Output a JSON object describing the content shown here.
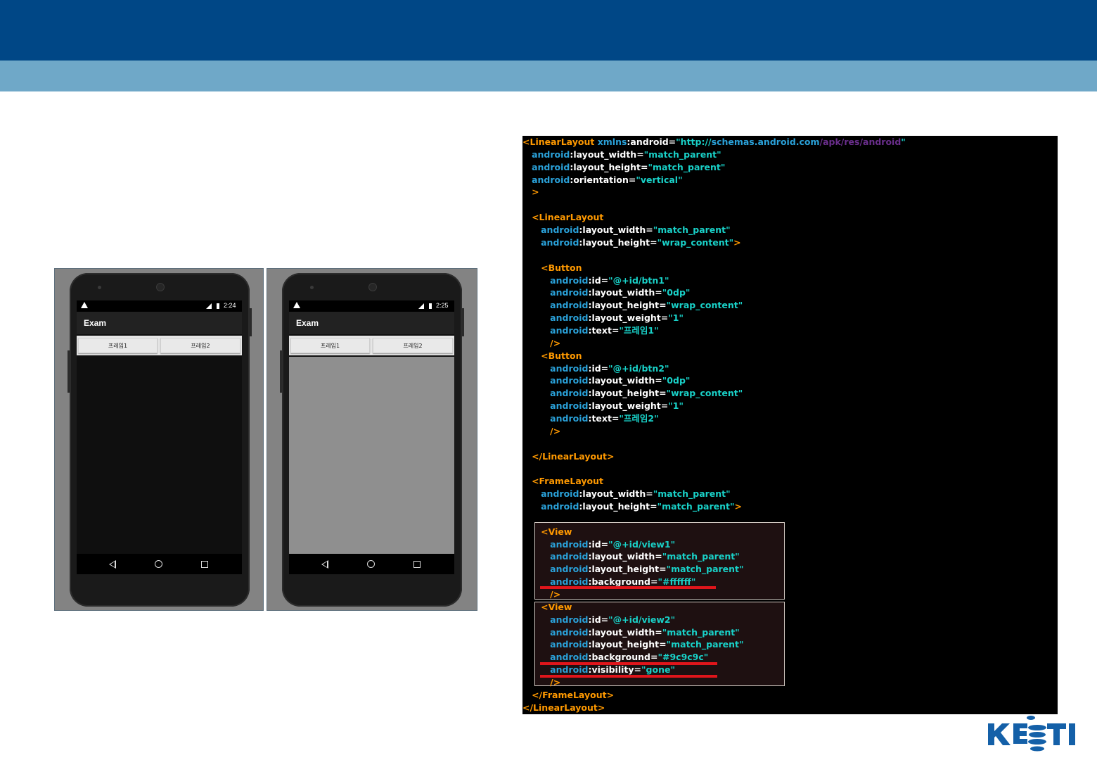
{
  "screenshots": [
    {
      "time": "2:24",
      "app_title": "Exam",
      "button1": "프레임1",
      "button2": "프레임2",
      "content_color": "#0f0f0f"
    },
    {
      "time": "2:25",
      "app_title": "Exam",
      "button1": "프레임1",
      "button2": "프레임2",
      "content_color": "#8f8f8f"
    }
  ],
  "code": {
    "lines": [
      [
        [
          "b",
          "<"
        ],
        [
          "b",
          "LinearLayout"
        ],
        [
          "n",
          " xmlns"
        ],
        [
          "p",
          ":android="
        ],
        [
          "v",
          "\"http://"
        ],
        [
          "n",
          "schemas.android.com"
        ],
        [
          "u",
          "/apk/res/android"
        ],
        [
          "v",
          "\""
        ]
      ],
      [
        [
          "p",
          "   "
        ],
        [
          "n",
          "android"
        ],
        [
          "p",
          ":layout_width="
        ],
        [
          "v",
          "\"match_parent\""
        ]
      ],
      [
        [
          "p",
          "   "
        ],
        [
          "n",
          "android"
        ],
        [
          "p",
          ":layout_height="
        ],
        [
          "v",
          "\"match_parent\""
        ]
      ],
      [
        [
          "p",
          "   "
        ],
        [
          "n",
          "android"
        ],
        [
          "p",
          ":orientation="
        ],
        [
          "v",
          "\"vertical\""
        ]
      ],
      [
        [
          "p",
          "   "
        ],
        [
          "b",
          ">"
        ]
      ],
      [],
      [
        [
          "p",
          "   "
        ],
        [
          "b",
          "<"
        ],
        [
          "b",
          "LinearLayout"
        ]
      ],
      [
        [
          "p",
          "      "
        ],
        [
          "n",
          "android"
        ],
        [
          "p",
          ":layout_width="
        ],
        [
          "v",
          "\"match_parent\""
        ]
      ],
      [
        [
          "p",
          "      "
        ],
        [
          "n",
          "android"
        ],
        [
          "p",
          ":layout_height="
        ],
        [
          "v",
          "\"wrap_content\""
        ],
        [
          "b",
          ">"
        ]
      ],
      [],
      [
        [
          "p",
          "      "
        ],
        [
          "b",
          "<"
        ],
        [
          "b",
          "Button"
        ]
      ],
      [
        [
          "p",
          "         "
        ],
        [
          "n",
          "android"
        ],
        [
          "p",
          ":id="
        ],
        [
          "v",
          "\"@+id/btn1\""
        ]
      ],
      [
        [
          "p",
          "         "
        ],
        [
          "n",
          "android"
        ],
        [
          "p",
          ":layout_width="
        ],
        [
          "v",
          "\"0dp\""
        ]
      ],
      [
        [
          "p",
          "         "
        ],
        [
          "n",
          "android"
        ],
        [
          "p",
          ":layout_height="
        ],
        [
          "v",
          "\"wrap_content\""
        ]
      ],
      [
        [
          "p",
          "         "
        ],
        [
          "n",
          "android"
        ],
        [
          "p",
          ":layout_weight="
        ],
        [
          "v",
          "\"1\""
        ]
      ],
      [
        [
          "p",
          "         "
        ],
        [
          "n",
          "android"
        ],
        [
          "p",
          ":text="
        ],
        [
          "v",
          "\"프레임1\""
        ]
      ],
      [
        [
          "p",
          "         "
        ],
        [
          "b",
          "/>"
        ]
      ],
      [
        [
          "p",
          "      "
        ],
        [
          "b",
          "<"
        ],
        [
          "b",
          "Button"
        ]
      ],
      [
        [
          "p",
          "         "
        ],
        [
          "n",
          "android"
        ],
        [
          "p",
          ":id="
        ],
        [
          "v",
          "\"@+id/btn2\""
        ]
      ],
      [
        [
          "p",
          "         "
        ],
        [
          "n",
          "android"
        ],
        [
          "p",
          ":layout_width="
        ],
        [
          "v",
          "\"0dp\""
        ]
      ],
      [
        [
          "p",
          "         "
        ],
        [
          "n",
          "android"
        ],
        [
          "p",
          ":layout_height="
        ],
        [
          "v",
          "\"wrap_content\""
        ]
      ],
      [
        [
          "p",
          "         "
        ],
        [
          "n",
          "android"
        ],
        [
          "p",
          ":layout_weight="
        ],
        [
          "v",
          "\"1\""
        ]
      ],
      [
        [
          "p",
          "         "
        ],
        [
          "n",
          "android"
        ],
        [
          "p",
          ":text="
        ],
        [
          "v",
          "\"프레임2\""
        ]
      ],
      [
        [
          "p",
          "         "
        ],
        [
          "b",
          "/>"
        ]
      ],
      [],
      [
        [
          "p",
          "   "
        ],
        [
          "b",
          "</"
        ],
        [
          "b",
          "LinearLayout"
        ],
        [
          "b",
          ">"
        ]
      ],
      [],
      [
        [
          "p",
          "   "
        ],
        [
          "b",
          "<"
        ],
        [
          "b",
          "FrameLayout"
        ]
      ],
      [
        [
          "p",
          "      "
        ],
        [
          "n",
          "android"
        ],
        [
          "p",
          ":layout_width="
        ],
        [
          "v",
          "\"match_parent\""
        ]
      ],
      [
        [
          "p",
          "      "
        ],
        [
          "n",
          "android"
        ],
        [
          "p",
          ":layout_height="
        ],
        [
          "v",
          "\"match_parent\""
        ],
        [
          "b",
          ">"
        ]
      ],
      [],
      [
        [
          "p",
          "      "
        ],
        [
          "b",
          "<"
        ],
        [
          "b",
          "View"
        ]
      ],
      [
        [
          "p",
          "         "
        ],
        [
          "n",
          "android"
        ],
        [
          "p",
          ":id="
        ],
        [
          "v",
          "\"@+id/view1\""
        ]
      ],
      [
        [
          "p",
          "         "
        ],
        [
          "n",
          "android"
        ],
        [
          "p",
          ":layout_width="
        ],
        [
          "v",
          "\"match_parent\""
        ]
      ],
      [
        [
          "p",
          "         "
        ],
        [
          "n",
          "android"
        ],
        [
          "p",
          ":layout_height="
        ],
        [
          "v",
          "\"match_parent\""
        ]
      ],
      [
        [
          "p",
          "         "
        ],
        [
          "n",
          "android"
        ],
        [
          "p",
          ":background="
        ],
        [
          "v",
          "\"#ffffff\""
        ]
      ],
      [
        [
          "p",
          "         "
        ],
        [
          "b",
          "/>"
        ]
      ],
      [
        [
          "p",
          "      "
        ],
        [
          "b",
          "<"
        ],
        [
          "b",
          "View"
        ]
      ],
      [
        [
          "p",
          "         "
        ],
        [
          "n",
          "android"
        ],
        [
          "p",
          ":id="
        ],
        [
          "v",
          "\"@+id/view2\""
        ]
      ],
      [
        [
          "p",
          "         "
        ],
        [
          "n",
          "android"
        ],
        [
          "p",
          ":layout_width="
        ],
        [
          "v",
          "\"match_parent\""
        ]
      ],
      [
        [
          "p",
          "         "
        ],
        [
          "n",
          "android"
        ],
        [
          "p",
          ":layout_height="
        ],
        [
          "v",
          "\"match_parent\""
        ]
      ],
      [
        [
          "p",
          "         "
        ],
        [
          "n",
          "android"
        ],
        [
          "p",
          ":background="
        ],
        [
          "v",
          "\"#9c9c9c\""
        ]
      ],
      [
        [
          "p",
          "         "
        ],
        [
          "n",
          "android"
        ],
        [
          "p",
          ":visibility="
        ],
        [
          "v",
          "\"gone\""
        ]
      ],
      [
        [
          "p",
          "         "
        ],
        [
          "b",
          "/>"
        ]
      ],
      [
        [
          "p",
          "   "
        ],
        [
          "b",
          "</"
        ],
        [
          "b",
          "FrameLayout"
        ],
        [
          "b",
          ">"
        ]
      ],
      [
        [
          "b",
          "</"
        ],
        [
          "b",
          "LinearLayout"
        ],
        [
          "b",
          ">"
        ]
      ]
    ]
  },
  "logo": {
    "text": "KETI",
    "color": "#1460a8"
  }
}
